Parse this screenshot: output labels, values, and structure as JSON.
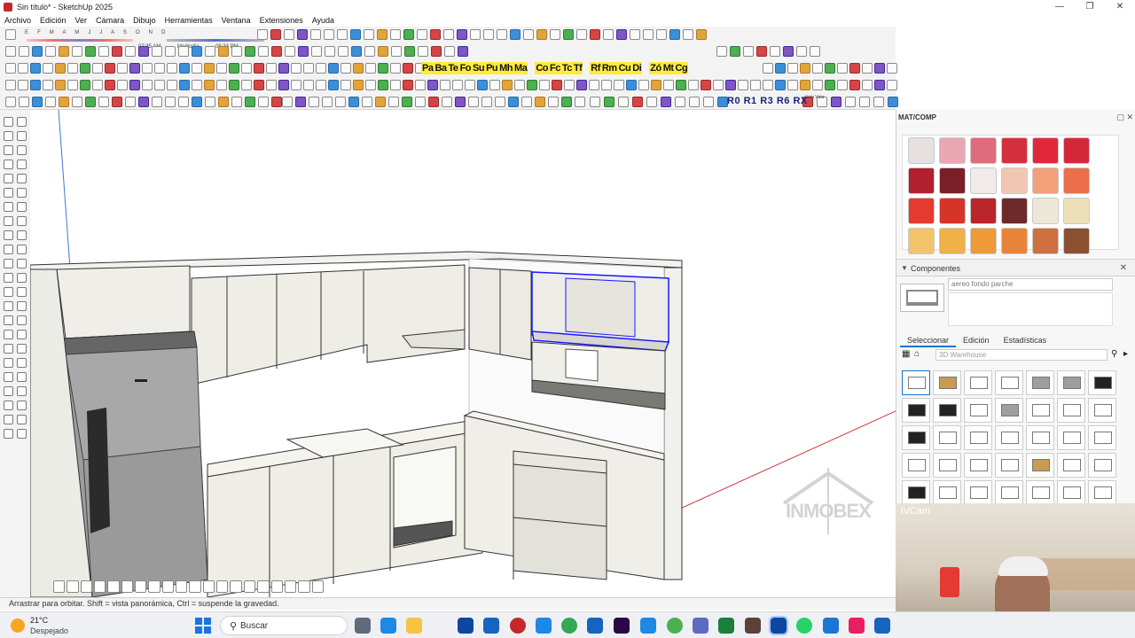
{
  "window": {
    "title": "Sin título* - SketchUp 2025"
  },
  "menu": [
    "Archivo",
    "Edición",
    "Ver",
    "Cámara",
    "Dibujo",
    "Herramientas",
    "Ventana",
    "Extensiones",
    "Ayuda"
  ],
  "sun": {
    "months": "E F M A M J J A S O N D",
    "time_start": "07:35 AM",
    "time_mid": "Mediodía",
    "time_end": "05:33 PM"
  },
  "plugin_bar": {
    "labels": [
      "Pa",
      "Ba",
      "Te",
      "Fo",
      "Su",
      "Pu",
      "Mh",
      "Ma",
      "Co",
      "Fc",
      "Tc",
      "Tf",
      "Rf",
      "Rm",
      "Cu",
      "Di",
      "Zó",
      "Mt",
      "Cg"
    ]
  },
  "rotation_buttons": "R0 R1 R3 R6 RX",
  "veta_labels": [
    "Veta",
    "Veta"
  ],
  "status_hint": "Arrastrar para orbitar. Shift = vista panorámica, Ctrl = suspende la gravedad.",
  "panel": {
    "title": "MAT/COMP",
    "components_label": "Componentes",
    "component_name": "aereo fondo parche",
    "tabs": [
      "Seleccionar",
      "Edición",
      "Estadísticas"
    ],
    "search_placeholder": "3D Warehouse",
    "swatch_colors": [
      "#e6e0e0",
      "#e8a7b3",
      "#e06b7b",
      "#d32f3e",
      "#e0283a",
      "#d4283a",
      "#b0202f",
      "#7a1e28",
      "#f0eaea",
      "#f1c7b4",
      "#f2a07a",
      "#ea6f4a",
      "#e53a2e",
      "#d63428",
      "#b8262a",
      "#6e2a28",
      "#ede7d8",
      "#ede0b8",
      "#f2c36a",
      "#f0b04a",
      "#ee9a3a",
      "#e8843a",
      "#cf7040",
      "#8a5030"
    ]
  },
  "webcam": {
    "label": "iVCam"
  },
  "watermark": {
    "text": "INMOBEX"
  },
  "taskbar": {
    "temp": "21°C",
    "condition": "Despejado",
    "search": "Buscar"
  }
}
